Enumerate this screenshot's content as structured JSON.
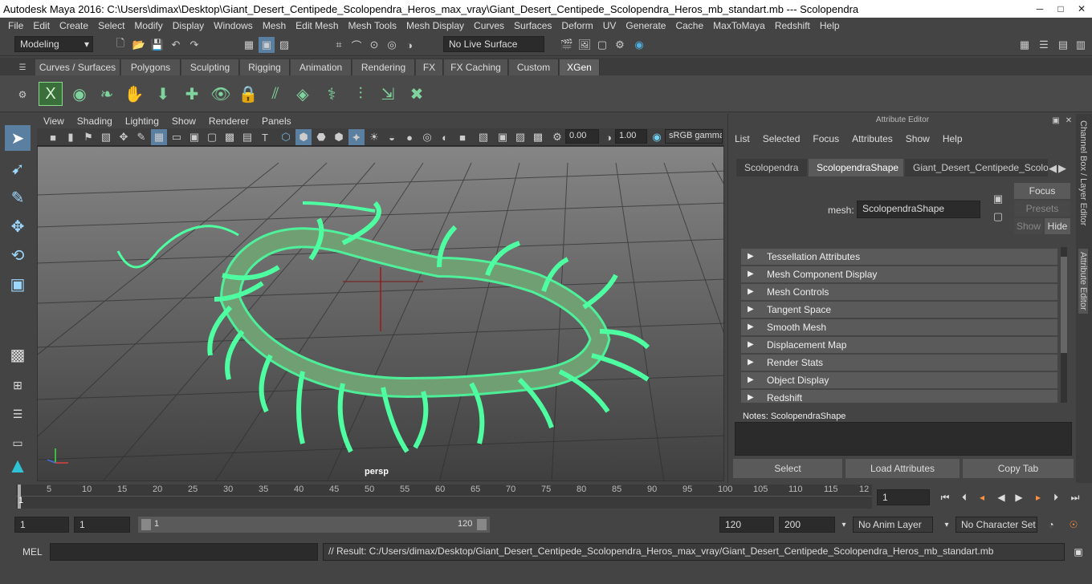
{
  "title": "Autodesk Maya 2016: C:\\Users\\dimax\\Desktop\\Giant_Desert_Centipede_Scolopendra_Heros_max_vray\\Giant_Desert_Centipede_Scolopendra_Heros_mb_standart.mb    ---    Scolopendra",
  "menus": [
    "File",
    "Edit",
    "Create",
    "Select",
    "Modify",
    "Display",
    "Windows",
    "Mesh",
    "Edit Mesh",
    "Mesh Tools",
    "Mesh Display",
    "Curves",
    "Surfaces",
    "Deform",
    "UV",
    "Generate",
    "Cache",
    "MaxToMaya",
    "Redshift",
    "Help"
  ],
  "status": {
    "mode": "Modeling",
    "live_surface": "No Live Surface"
  },
  "shelf_tabs": [
    "Curves / Surfaces",
    "Polygons",
    "Sculpting",
    "Rigging",
    "Animation",
    "Rendering",
    "FX",
    "FX Caching",
    "Custom",
    "XGen"
  ],
  "shelf_active": "XGen",
  "viewport": {
    "menus": [
      "View",
      "Shading",
      "Lighting",
      "Show",
      "Renderer",
      "Panels"
    ],
    "field1": "0.00",
    "field2": "1.00",
    "colorspace": "sRGB gamma",
    "camera": "persp"
  },
  "attribute_editor": {
    "title": "Attribute Editor",
    "menus": [
      "List",
      "Selected",
      "Focus",
      "Attributes",
      "Show",
      "Help"
    ],
    "tabs": [
      "Scolopendra",
      "ScolopendraShape",
      "Giant_Desert_Centipede_Scolop"
    ],
    "active_tab": "ScolopendraShape",
    "mesh_label": "mesh:",
    "mesh_value": "ScolopendraShape",
    "focus_btn": "Focus",
    "presets_btn": "Presets",
    "show_btn": "Show",
    "hide_btn": "Hide",
    "sections": [
      "Tessellation Attributes",
      "Mesh Component Display",
      "Mesh Controls",
      "Tangent Space",
      "Smooth Mesh",
      "Displacement Map",
      "Render Stats",
      "Object Display",
      "Redshift"
    ],
    "notes_label": "Notes:  ScolopendraShape",
    "buttons": [
      "Select",
      "Load Attributes",
      "Copy Tab"
    ]
  },
  "side_tabs": [
    "Channel Box / Layer Editor",
    "Attribute Editor"
  ],
  "timeline": {
    "ticks": [
      "5",
      "10",
      "15",
      "20",
      "25",
      "30",
      "35",
      "40",
      "45",
      "50",
      "55",
      "60",
      "65",
      "70",
      "75",
      "80",
      "85",
      "90",
      "95",
      "100",
      "105",
      "110",
      "115",
      "12"
    ],
    "start_marker": "1",
    "current_frame": "1"
  },
  "range": {
    "start": "1",
    "playback_start": "1",
    "slider_start": "1",
    "slider_end": "120",
    "playback_end": "120",
    "end": "200",
    "anim_layer": "No Anim Layer",
    "char_set": "No Character Set"
  },
  "command": {
    "label": "MEL",
    "result": "// Result: C:/Users/dimax/Desktop/Giant_Desert_Centipede_Scolopendra_Heros_max_vray/Giant_Desert_Centipede_Scolopendra_Heros_mb_standart.mb"
  }
}
